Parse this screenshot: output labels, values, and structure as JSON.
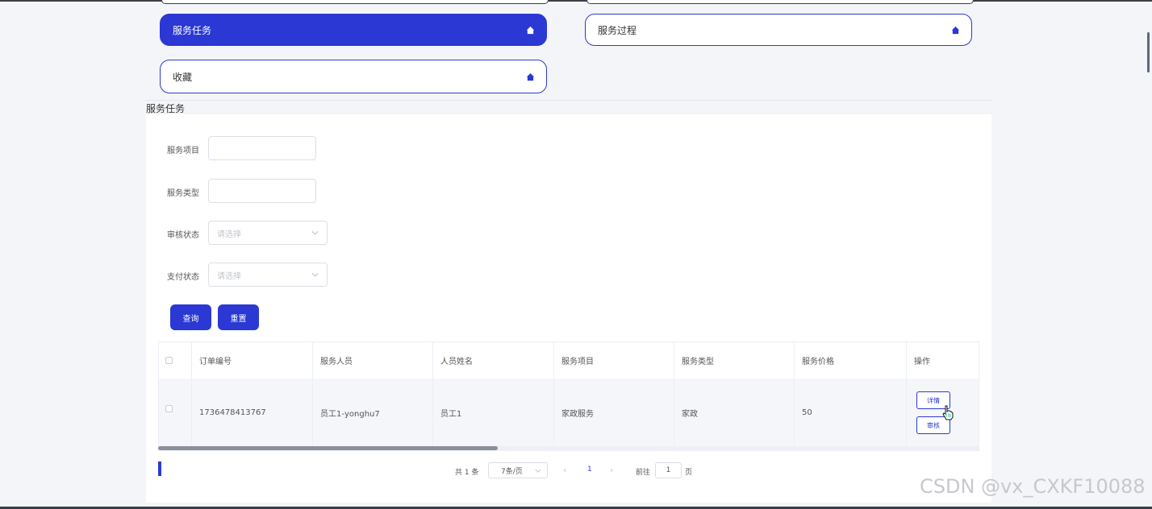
{
  "nav": {
    "cards": [
      {
        "label": "服务任务",
        "icon": "house-icon",
        "active": true
      },
      {
        "label": "服务过程",
        "icon": "house-icon",
        "active": false
      },
      {
        "label": "收藏",
        "icon": "house-icon",
        "active": false
      }
    ]
  },
  "section": {
    "title": "服务任务"
  },
  "search": {
    "fields": [
      {
        "label": "服务项目",
        "value": ""
      },
      {
        "label": "服务类型",
        "value": ""
      },
      {
        "label": "审核状态",
        "placeholder": "请选择"
      },
      {
        "label": "支付状态",
        "placeholder": "请选择"
      }
    ],
    "query_label": "查询",
    "reset_label": "重置"
  },
  "table": {
    "columns": [
      "订单编号",
      "服务人员",
      "人员姓名",
      "服务项目",
      "服务类型",
      "服务价格",
      "操作"
    ],
    "rows": [
      {
        "order_no": "1736478413767",
        "staff": "员工1-yonghu7",
        "name": "员工1",
        "item": "家政服务",
        "type": "家政",
        "price": "50",
        "actions": [
          "详情",
          "审核"
        ]
      }
    ]
  },
  "pagination": {
    "total": "共 1 条",
    "page_size": "7条/页",
    "current_page": "1",
    "goto_label": "前往",
    "goto_value": "1",
    "page_suffix": "页"
  },
  "watermark": "CSDN @vx_CXKF10088",
  "colors": {
    "accent": "#2b38d4",
    "background": "#f4f5f8"
  }
}
